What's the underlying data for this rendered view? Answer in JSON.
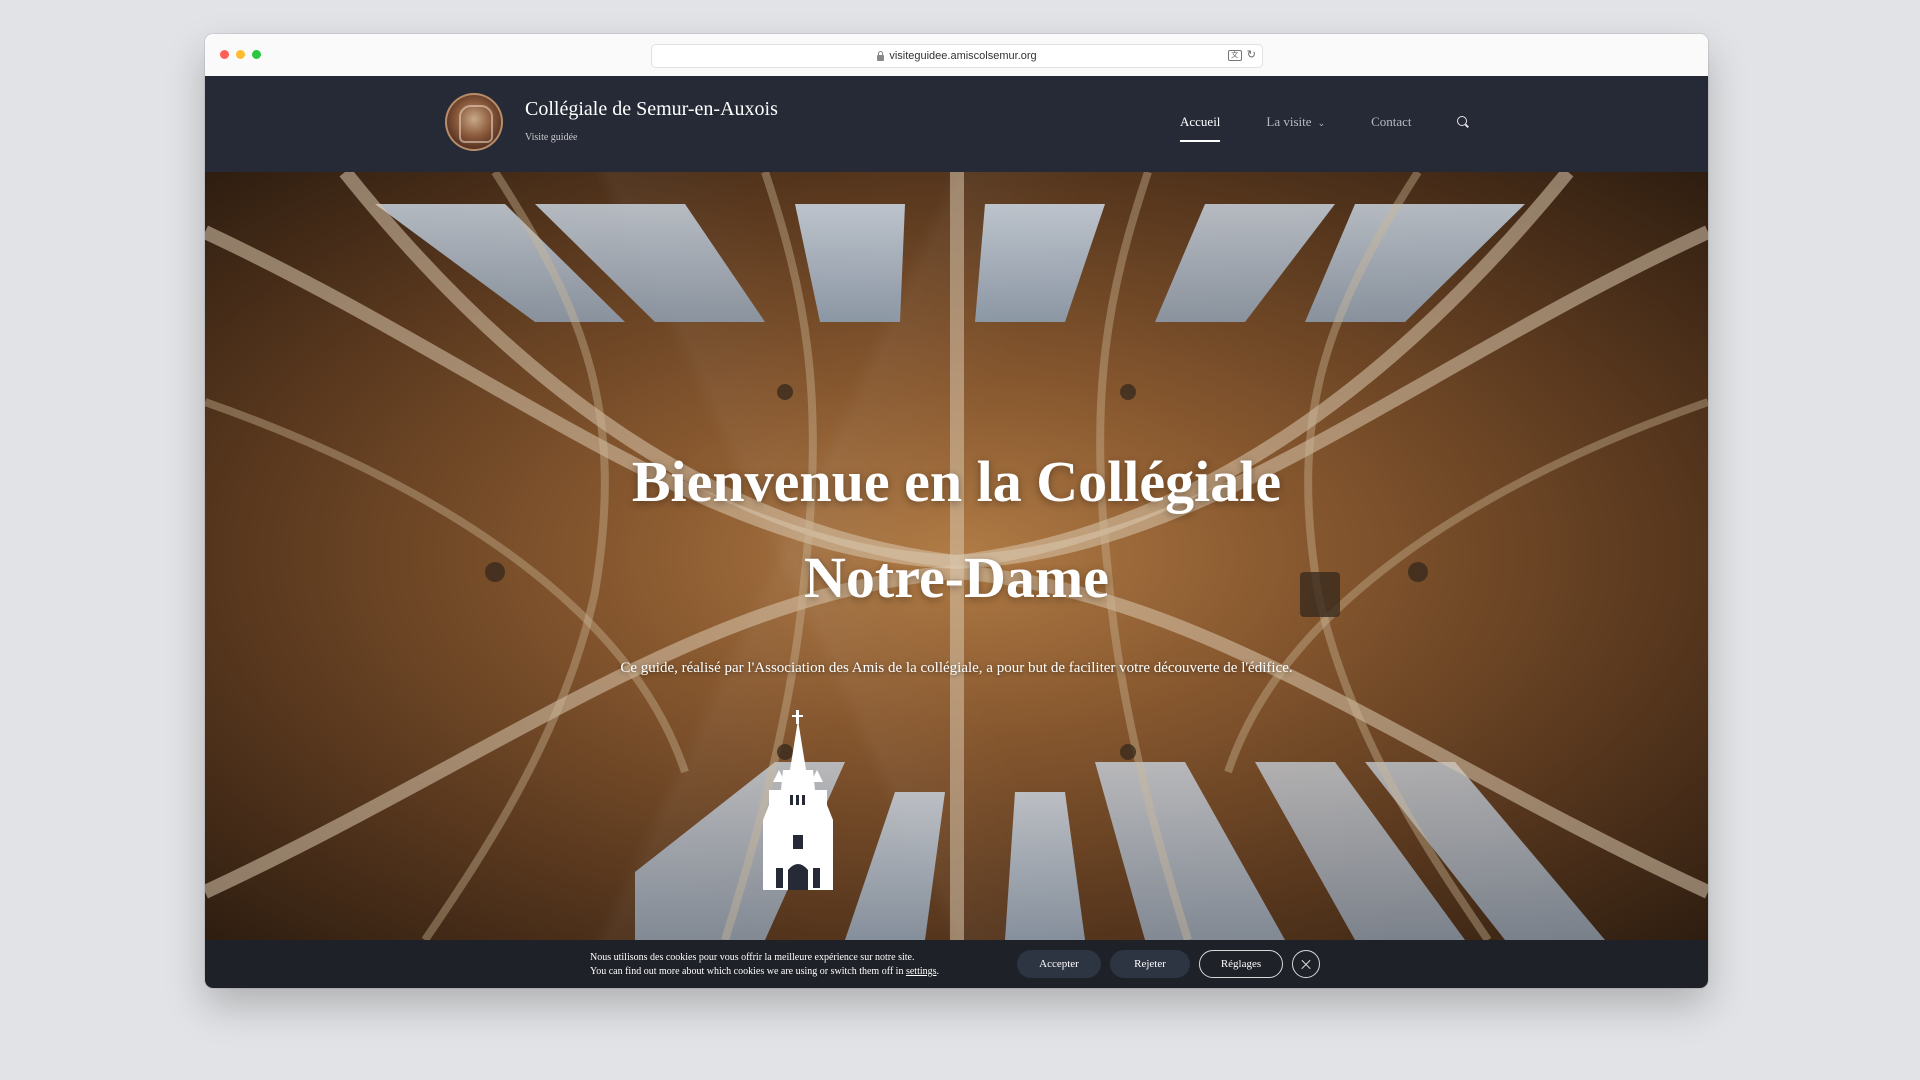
{
  "browser": {
    "url": "visiteguidee.amiscolsemur.org",
    "traffic_lights": [
      "#ff5f57",
      "#febc2e",
      "#28c840"
    ]
  },
  "header": {
    "site_title": "Collégiale de Semur-en-Auxois",
    "tagline": "Visite guidée",
    "nav": {
      "home": "Accueil",
      "visit": "La visite",
      "contact": "Contact"
    }
  },
  "hero": {
    "title_line1": "Bienvenue en la Collégiale",
    "title_line2": "Notre-Dame",
    "subtitle": "Ce guide, réalisé par l'Association des Amis de la collégiale, a pour but de faciliter votre découverte de l'édifice."
  },
  "cookie_banner": {
    "line1": "Nous utilisons des cookies pour vous offrir la meilleure expérience sur notre site.",
    "line2_prefix": "You can find out more about which cookies we are using or switch them off in",
    "line2_link": "settings",
    "line2_suffix": ".",
    "accept": "Accepter",
    "reject": "Rejeter",
    "settings": "Réglages"
  },
  "colors": {
    "header_bg": "#262a36",
    "cookie_bg": "#1f2128",
    "button_bg": "#2d3442"
  }
}
